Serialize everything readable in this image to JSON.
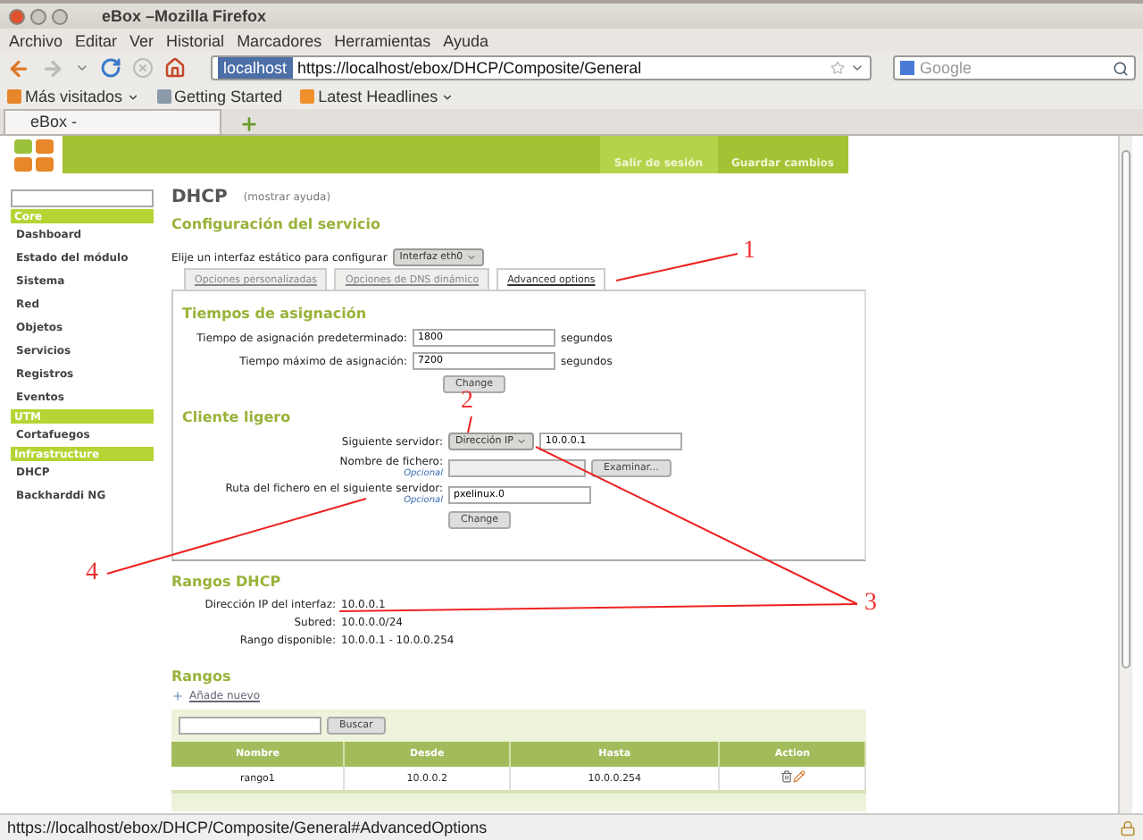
{
  "window": {
    "title": "eBox –Mozilla Firefox"
  },
  "menu": [
    "Archivo",
    "Editar",
    "Ver",
    "Historial",
    "Marcadores",
    "Herramientas",
    "Ayuda"
  ],
  "url_bar": {
    "site": "localhost",
    "url": "https://localhost/ebox/DHCP/Composite/General"
  },
  "search": {
    "placeholder": "Google"
  },
  "bookmarks": [
    {
      "label": "Más visitados",
      "menu": true
    },
    {
      "label": "Getting Started",
      "menu": false
    },
    {
      "label": "Latest Headlines",
      "menu": true
    }
  ],
  "browser_tabs": [
    {
      "label": "eBox -",
      "selected": true
    }
  ],
  "header": {
    "buttons": [
      "Salir de sesión",
      "Guardar cambios"
    ]
  },
  "sidebar": {
    "sections": [
      {
        "title": "Core",
        "items": [
          "Dashboard",
          "Estado del módulo",
          "Sistema",
          "Red",
          "Objetos",
          "Servicios",
          "Registros",
          "Eventos"
        ]
      },
      {
        "title": "UTM",
        "items": [
          "Cortafuegos"
        ]
      },
      {
        "title": "Infrastructure",
        "items": [
          "DHCP",
          "Backharddi NG"
        ]
      }
    ]
  },
  "page": {
    "title": "DHCP",
    "help_link": "(mostrar ayuda)",
    "section_title": "Configuración del servicio",
    "interface_label": "Elije un interfaz estático para configurar",
    "interface_select": "Interfaz eth0"
  },
  "tabs": [
    {
      "label": "Opciones personalizadas",
      "selected": false
    },
    {
      "label": "Opciones de DNS dinámico",
      "selected": false
    },
    {
      "label": "Advanced options",
      "selected": true
    }
  ],
  "lease": {
    "title": "Tiempos de asignación",
    "rows": [
      {
        "label": "Tiempo de asignación predeterminado:",
        "value": "1800",
        "unit": "segundos"
      },
      {
        "label": "Tiempo máximo de asignación:",
        "value": "7200",
        "unit": "segundos"
      }
    ],
    "button": "Change"
  },
  "thin_client": {
    "title": "Cliente ligero",
    "next_server": {
      "label": "Siguiente servidor:",
      "select": "Dirección IP",
      "value": "10.0.0.1"
    },
    "filename": {
      "label": "Nombre de fichero:",
      "optional": "Opcional",
      "browse": "Examinar..."
    },
    "path": {
      "label": "Ruta del fichero en el siguiente servidor:",
      "optional": "Opcional",
      "value": "pxelinux.0"
    },
    "button": "Change"
  },
  "ranges_info": {
    "title": "Rangos DHCP",
    "rows": [
      {
        "label": "Dirección IP del interfaz:",
        "value": "10.0.0.1"
      },
      {
        "label": "Subred:",
        "value": "10.0.0.0/24"
      },
      {
        "label": "Rango disponible:",
        "value": "10.0.0.1 - 10.0.0.254"
      }
    ]
  },
  "ranges": {
    "title": "Rangos",
    "add_link": "Añade nuevo",
    "search_button": "Buscar",
    "columns": [
      "Nombre",
      "Desde",
      "Hasta",
      "Action"
    ],
    "rows": [
      {
        "cells": [
          "rango1",
          "10.0.0.2",
          "10.0.0.254"
        ]
      }
    ]
  },
  "status_bar": "https://localhost/ebox/DHCP/Composite/General#AdvancedOptions",
  "annotations": [
    {
      "label": "1"
    },
    {
      "label": "2"
    },
    {
      "label": "3"
    },
    {
      "label": "4"
    }
  ]
}
